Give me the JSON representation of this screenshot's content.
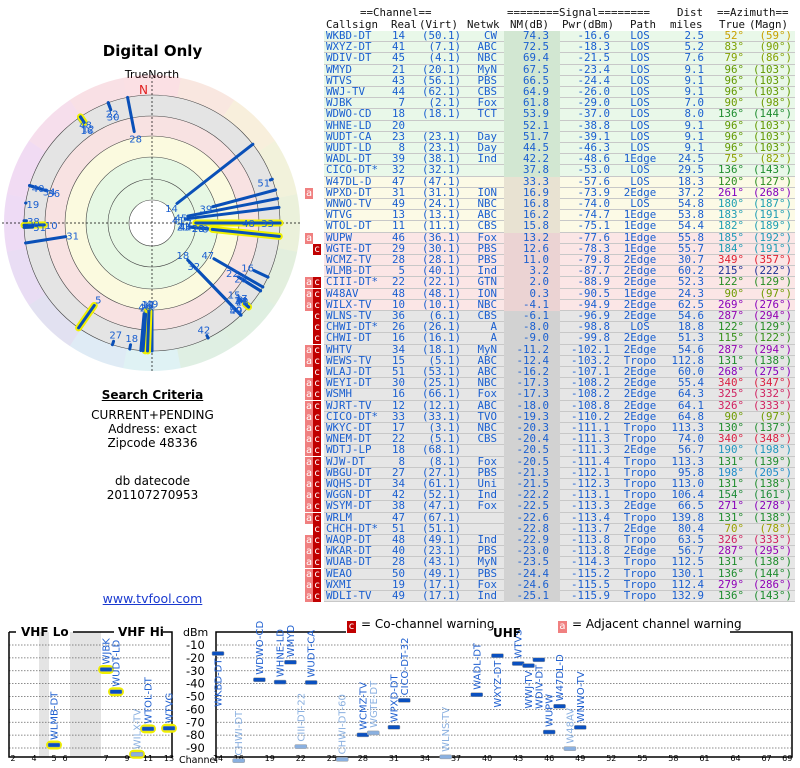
{
  "polar": {
    "title": "Digital Only",
    "north_label": "TrueNorth",
    "north_marker": "N"
  },
  "criteria": {
    "heading": "Search Criteria",
    "mode": "CURRENT+PENDING",
    "address": "Address: exact",
    "zipcode": "Zipcode 48336",
    "datecode_label": "db datecode",
    "datecode": "201107270953"
  },
  "link": "www.tvfool.com",
  "table": {
    "group_channel": "==Channel==",
    "group_signal": "========Signal========",
    "group_dist": "Dist",
    "group_azimuth": "==Azimuth==",
    "columns": [
      "Callsign",
      "Real",
      "(Virt)",
      "Netwk",
      "NM(dB)",
      "Pwr(dBm)",
      "Path",
      "miles",
      "True",
      "(Magn)"
    ],
    "row_fields": [
      "flags",
      "callsign",
      "real",
      "virt",
      "netwk",
      "nm",
      "pwr",
      "path",
      "dist",
      "true",
      "magn",
      "band"
    ],
    "rows": [
      [
        "",
        "WKBD-DT",
        "14",
        "(50.1)",
        "CW",
        "74.3",
        "-16.6",
        "LOS",
        "2.5",
        "52°",
        "(59°)",
        "green"
      ],
      [
        "",
        "WXYZ-DT",
        "41",
        "(7.1)",
        "ABC",
        "72.5",
        "-18.3",
        "LOS",
        "5.2",
        "83°",
        "(90°)",
        "green"
      ],
      [
        "",
        "WDIV-DT",
        "45",
        "(4.1)",
        "NBC",
        "69.4",
        "-21.5",
        "LOS",
        "7.6",
        "79°",
        "(86°)",
        "green"
      ],
      [
        "",
        "WMYD",
        "21",
        "(20.1)",
        "MyN",
        "67.5",
        "-23.4",
        "LOS",
        "9.1",
        "96°",
        "(103°)",
        "green"
      ],
      [
        "",
        "WTVS",
        "43",
        "(56.1)",
        "PBS",
        "66.5",
        "-24.4",
        "LOS",
        "9.1",
        "96°",
        "(103°)",
        "green"
      ],
      [
        "",
        "WWJ-TV",
        "44",
        "(62.1)",
        "CBS",
        "64.9",
        "-26.0",
        "LOS",
        "9.1",
        "96°",
        "(103°)",
        "green"
      ],
      [
        "",
        "WJBK",
        "7",
        "(2.1)",
        "Fox",
        "61.8",
        "-29.0",
        "LOS",
        "7.0",
        "90°",
        "(98°)",
        "green"
      ],
      [
        "",
        "WDWO-CD",
        "18",
        "(18.1)",
        "TCT",
        "53.9",
        "-37.0",
        "LOS",
        "8.0",
        "136°",
        "(144°)",
        "green"
      ],
      [
        "",
        "WHNE-LD",
        "20",
        "",
        "",
        "52.1",
        "-38.8",
        "LOS",
        "9.1",
        "96°",
        "(103°)",
        "green"
      ],
      [
        "",
        "WUDT-CA",
        "23",
        "(23.1)",
        "Day",
        "51.7",
        "-39.1",
        "LOS",
        "9.1",
        "96°",
        "(103°)",
        "green"
      ],
      [
        "",
        "WUDT-LD",
        "8",
        "(23.1)",
        "Day",
        "44.5",
        "-46.3",
        "LOS",
        "9.1",
        "96°",
        "(103°)",
        "green"
      ],
      [
        "",
        "WADL-DT",
        "39",
        "(38.1)",
        "Ind",
        "42.2",
        "-48.6",
        "1Edge",
        "24.5",
        "75°",
        "(82°)",
        "green"
      ],
      [
        "",
        "CICO-DT*",
        "32",
        "(32.1)",
        "",
        "37.8",
        "-53.0",
        "LOS",
        "29.5",
        "136°",
        "(143°)",
        "green"
      ],
      [
        "",
        "W47DL-D",
        "47",
        "(47.1)",
        "",
        "33.3",
        "-57.6",
        "LOS",
        "18.3",
        "120°",
        "(127°)",
        "yellow"
      ],
      [
        "a",
        "WPXD-DT",
        "31",
        "(31.1)",
        "ION",
        "16.9",
        "-73.9",
        "2Edge",
        "37.2",
        "261°",
        "(268°)",
        "yellow"
      ],
      [
        "",
        "WNWO-TV",
        "49",
        "(24.1)",
        "NBC",
        "16.8",
        "-74.0",
        "LOS",
        "54.8",
        "180°",
        "(187°)",
        "yellow"
      ],
      [
        "",
        "WTVG",
        "13",
        "(13.1)",
        "ABC",
        "16.2",
        "-74.7",
        "1Edge",
        "53.8",
        "183°",
        "(191°)",
        "yellow"
      ],
      [
        "",
        "WTOL-DT",
        "11",
        "(11.1)",
        "CBS",
        "15.8",
        "-75.1",
        "1Edge",
        "54.4",
        "182°",
        "(189°)",
        "yellow"
      ],
      [
        "a",
        "WUPW",
        "46",
        "(36.1)",
        "Fox",
        "13.2",
        "-77.6",
        "1Edge",
        "55.8",
        "185°",
        "(192°)",
        "pink"
      ],
      [
        "c",
        "WGTE-DT",
        "29",
        "(30.1)",
        "PBS",
        "12.6",
        "-78.3",
        "1Edge",
        "55.7",
        "184°",
        "(191°)",
        "pink"
      ],
      [
        "",
        "WCMZ-TV",
        "28",
        "(28.1)",
        "PBS",
        "11.0",
        "-79.8",
        "2Edge",
        "30.7",
        "349°",
        "(357°)",
        "pink"
      ],
      [
        "",
        "WLMB-DT",
        "5",
        "(40.1)",
        "Ind",
        "3.2",
        "-87.7",
        "2Edge",
        "60.2",
        "215°",
        "(222°)",
        "pink"
      ],
      [
        "ac",
        "CIII-DT*",
        "22",
        "(22.1)",
        "GTN",
        "2.0",
        "-88.9",
        "2Edge",
        "52.3",
        "122°",
        "(129°)",
        "pink"
      ],
      [
        "ac",
        "W48AV",
        "48",
        "(48.1)",
        "ION",
        "0.3",
        "-90.5",
        "1Edge",
        "24.3",
        "90°",
        "(97°)",
        "pink"
      ],
      [
        "ac",
        "WILX-TV",
        "10",
        "(10.1)",
        "NBC",
        "-4.1",
        "-94.9",
        "2Edge",
        "62.5",
        "269°",
        "(276°)",
        "pink"
      ],
      [
        "c",
        "WLNS-TV",
        "36",
        "(6.1)",
        "CBS",
        "-6.1",
        "-96.9",
        "2Edge",
        "54.6",
        "287°",
        "(294°)",
        "gray"
      ],
      [
        "c",
        "CHWI-DT*",
        "26",
        "(26.1)",
        "A",
        "-8.0",
        "-98.8",
        "LOS",
        "18.8",
        "122°",
        "(129°)",
        "gray"
      ],
      [
        "c",
        "CHWI-DT",
        "16",
        "(16.1)",
        "A",
        "-9.0",
        "-99.8",
        "2Edge",
        "51.3",
        "115°",
        "(122°)",
        "gray"
      ],
      [
        "ac",
        "WHTV",
        "34",
        "(18.1)",
        "MyN",
        "-11.2",
        "-102.1",
        "2Edge",
        "54.6",
        "287°",
        "(294°)",
        "gray"
      ],
      [
        "ac",
        "WEWS-TV",
        "15",
        "(5.1)",
        "ABC",
        "-12.4",
        "-103.2",
        "Tropo",
        "112.8",
        "131°",
        "(138°)",
        "gray"
      ],
      [
        "c",
        "WLAJ-DT",
        "51",
        "(53.1)",
        "ABC",
        "-16.2",
        "-107.1",
        "2Edge",
        "60.0",
        "268°",
        "(275°)",
        "gray"
      ],
      [
        "ac",
        "WEYI-DT",
        "30",
        "(25.1)",
        "NBC",
        "-17.3",
        "-108.2",
        "2Edge",
        "55.4",
        "340°",
        "(347°)",
        "gray"
      ],
      [
        "ac",
        "WSMH",
        "16",
        "(66.1)",
        "Fox",
        "-17.3",
        "-108.2",
        "2Edge",
        "64.3",
        "325°",
        "(332°)",
        "gray"
      ],
      [
        "ac",
        "WJRT-TV",
        "12",
        "(12.1)",
        "ABC",
        "-18.0",
        "-108.8",
        "2Edge",
        "64.1",
        "326°",
        "(333°)",
        "gray"
      ],
      [
        "ac",
        "CICO-DT*",
        "33",
        "(33.1)",
        "TVO",
        "-19.3",
        "-110.2",
        "2Edge",
        "64.8",
        "90°",
        "(97°)",
        "gray"
      ],
      [
        "ac",
        "WKYC-DT",
        "17",
        "(3.1)",
        "NBC",
        "-20.3",
        "-111.1",
        "Tropo",
        "113.3",
        "130°",
        "(137°)",
        "gray"
      ],
      [
        "ac",
        "WNEM-DT",
        "22",
        "(5.1)",
        "CBS",
        "-20.4",
        "-111.3",
        "Tropo",
        "74.0",
        "340°",
        "(348°)",
        "gray"
      ],
      [
        "ac",
        "WDTJ-LP",
        "18",
        "(68.1)",
        "",
        "-20.5",
        "-111.3",
        "2Edge",
        "56.7",
        "190°",
        "(198°)",
        "gray"
      ],
      [
        "ac",
        "WJW-DT",
        "8",
        "(8.1)",
        "Fox",
        "-20.5",
        "-111.4",
        "Tropo",
        "113.3",
        "131°",
        "(139°)",
        "gray"
      ],
      [
        "ac",
        "WBGU-DT",
        "27",
        "(27.1)",
        "PBS",
        "-21.3",
        "-112.1",
        "Tropo",
        "95.8",
        "198°",
        "(205°)",
        "gray"
      ],
      [
        "ac",
        "WQHS-DT",
        "34",
        "(61.1)",
        "Uni",
        "-21.5",
        "-112.3",
        "Tropo",
        "113.0",
        "131°",
        "(138°)",
        "gray"
      ],
      [
        "ac",
        "WGGN-DT",
        "42",
        "(52.1)",
        "Ind",
        "-22.2",
        "-113.1",
        "Tropo",
        "106.4",
        "154°",
        "(161°)",
        "gray"
      ],
      [
        "ac",
        "WSYM-DT",
        "38",
        "(47.1)",
        "Fox",
        "-22.5",
        "-113.3",
        "2Edge",
        "66.5",
        "271°",
        "(278°)",
        "gray"
      ],
      [
        "ac",
        "WRLM",
        "47",
        "(67.1)",
        "",
        "-22.6",
        "-113.4",
        "Tropo",
        "139.8",
        "131°",
        "(138°)",
        "gray"
      ],
      [
        "c",
        "CHCH-DT*",
        "51",
        "(51.1)",
        "",
        "-22.8",
        "-113.7",
        "2Edge",
        "80.4",
        "70°",
        "(78°)",
        "gray"
      ],
      [
        "ac",
        "WAQP-DT",
        "48",
        "(49.1)",
        "Ind",
        "-22.9",
        "-113.8",
        "Tropo",
        "63.5",
        "326°",
        "(333°)",
        "gray"
      ],
      [
        "ac",
        "WKAR-DT",
        "40",
        "(23.1)",
        "PBS",
        "-23.0",
        "-113.8",
        "2Edge",
        "56.7",
        "287°",
        "(295°)",
        "gray"
      ],
      [
        "ac",
        "WUAB-DT",
        "28",
        "(43.1)",
        "MyN",
        "-23.5",
        "-114.3",
        "Tropo",
        "112.5",
        "131°",
        "(138°)",
        "gray"
      ],
      [
        "ac",
        "WEAO",
        "50",
        "(49.1)",
        "PBS",
        "-24.4",
        "-115.2",
        "Tropo",
        "130.1",
        "136°",
        "(144°)",
        "gray"
      ],
      [
        "ac",
        "WXMI",
        "19",
        "(17.1)",
        "Fox",
        "-24.6",
        "-115.5",
        "Tropo",
        "112.4",
        "279°",
        "(286°)",
        "gray"
      ],
      [
        "ac",
        "WDLI-TV",
        "49",
        "(17.1)",
        "Ind",
        "-25.1",
        "-115.9",
        "Tropo",
        "132.9",
        "136°",
        "(143°)",
        "gray"
      ]
    ]
  },
  "legend": {
    "co_flag": "c",
    "co_text": "= Co-channel warning",
    "adj_flag": "a",
    "adj_text": "= Adjacent channel warning"
  },
  "spectrum": {
    "vhf_lo_label": "VHF Lo",
    "vhf_hi_label": "VHF Hi",
    "uhf_label": "UHF",
    "unit_label": "dBm",
    "channel_label": "Channel",
    "dbm_ticks": [
      "-10",
      "-20",
      "-30",
      "-40",
      "-50",
      "-60",
      "-70",
      "-80",
      "-90"
    ],
    "vhf_channel_ticks": [
      "2",
      "4",
      "5",
      "6",
      "7",
      "9",
      "11",
      "13"
    ],
    "uhf_channel_ticks": [
      "14",
      "16",
      "19",
      "22",
      "25",
      "28",
      "31",
      "34",
      "37",
      "40",
      "43",
      "46",
      "49",
      "52",
      "55",
      "58",
      "61",
      "64",
      "67",
      "69"
    ],
    "station_fields": [
      "label",
      "channel",
      "dbm",
      "faded"
    ],
    "stations": [
      [
        "WLMB-DT",
        5,
        -87.7,
        false
      ],
      [
        "WJBK",
        7,
        -29.0,
        false
      ],
      [
        "WUDT-LD",
        8,
        -46.3,
        false
      ],
      [
        "WILX-TV",
        10,
        -94.9,
        true
      ],
      [
        "WTOL-DT",
        11,
        -75.1,
        false
      ],
      [
        "WTVG",
        13,
        -74.7,
        false
      ],
      [
        "WKBD-DT",
        14,
        -16.6,
        false
      ],
      [
        "CHWI-DT",
        16,
        -99.8,
        true
      ],
      [
        "WDWO-CD",
        18,
        -37.0,
        false
      ],
      [
        "WHNE-LD",
        20,
        -38.8,
        false
      ],
      [
        "WMYD",
        21,
        -23.4,
        false
      ],
      [
        "CIII-DT-22",
        22,
        -88.9,
        true
      ],
      [
        "WUDT-CA",
        23,
        -39.1,
        false
      ],
      [
        "CHWI-DT-60",
        26,
        -98.8,
        true
      ],
      [
        "WCMZ-TV",
        28,
        -79.8,
        false
      ],
      [
        "WGTE-DT",
        29,
        -78.3,
        true
      ],
      [
        "WPXD-DT",
        31,
        -73.9,
        false
      ],
      [
        "CICO-DT-32",
        32,
        -53.0,
        false
      ],
      [
        "WLNS-TV",
        36,
        -96.9,
        true
      ],
      [
        "WADL-DT",
        39,
        -48.6,
        false
      ],
      [
        "WXYZ-DT",
        41,
        -18.3,
        false
      ],
      [
        "WTVS",
        43,
        -24.4,
        false
      ],
      [
        "WWJ-TV",
        44,
        -26.0,
        false
      ],
      [
        "WDIV-DT",
        45,
        -21.5,
        false
      ],
      [
        "WUPW",
        46,
        -77.6,
        false
      ],
      [
        "W47DL-D",
        47,
        -57.6,
        false
      ],
      [
        "W48AV",
        48,
        -90.5,
        true
      ],
      [
        "WNWO-TV",
        49,
        -74.0,
        false
      ]
    ]
  },
  "colors": {
    "link": "#1a3ad0",
    "table_text": "#1a5fd0",
    "adjacent_flag": "#f08080",
    "cochannel_flag": "#c00000",
    "marker": "#0a50c0",
    "vhf_highlight": "#f0f000",
    "north": "#e02020"
  }
}
